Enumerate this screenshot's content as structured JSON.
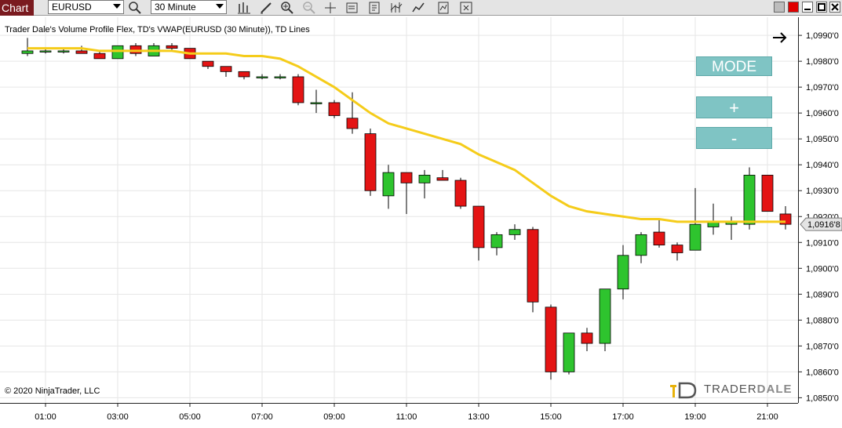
{
  "toolbar": {
    "tab_label": "Chart",
    "instrument": "EURUSD",
    "timeframe": "30 Minute",
    "icons": [
      "search-icon",
      "bar-type-icon",
      "draw-pencil-icon",
      "zoom-in-icon",
      "zoom-out-icon",
      "crosshair-icon",
      "data-box-icon",
      "properties-icon",
      "strategies-icon",
      "indicators-icon",
      "template-icon",
      "share-icon"
    ],
    "window_buttons": [
      "minimize",
      "restore",
      "maximize",
      "close"
    ]
  },
  "chart": {
    "indicator_label": "Trader Dale's Volume Profile Flex, TD's VWAP(EURUSD (30 Minute)), TD Lines",
    "copyright": "© 2020 NinjaTrader, LLC",
    "logo_text_1": "TRADER",
    "logo_text_2": "DALE",
    "mode_label": "MODE",
    "plus_label": "+",
    "minus_label": "-",
    "colors": {
      "up": "#2ec42e",
      "down": "#e41414",
      "vwap": "#f5cc1a",
      "grid": "#e6e6e6",
      "panel": "#7fc4c4"
    }
  },
  "chart_data": {
    "type": "candlestick",
    "title": "EURUSD (30 Minute)",
    "y_ticks": [
      "1,0990'0",
      "1,0980'0",
      "1,0970'0",
      "1,0960'0",
      "1,0950'0",
      "1,0940'0",
      "1,0930'0",
      "1,0920'0",
      "1,0910'0",
      "1,0900'0",
      "1,0890'0",
      "1,0880'0",
      "1,0870'0",
      "1,0860'0",
      "1,0850'0"
    ],
    "ylim": [
      1.0848,
      1.0997
    ],
    "x_ticks": [
      "01:00",
      "03:00",
      "05:00",
      "07:00",
      "09:00",
      "11:00",
      "13:00",
      "15:00",
      "17:00",
      "19:00",
      "21:00"
    ],
    "current_price_label": "1,0916'8",
    "candles": [
      {
        "o": 1.0983,
        "h": 1.0989,
        "l": 1.0982,
        "c": 1.0984
      },
      {
        "o": 1.0984,
        "h": 1.0985,
        "l": 1.0983,
        "c": 1.0984
      },
      {
        "o": 1.0984,
        "h": 1.0985,
        "l": 1.0983,
        "c": 1.0984
      },
      {
        "o": 1.0984,
        "h": 1.0986,
        "l": 1.0983,
        "c": 1.0983
      },
      {
        "o": 1.0983,
        "h": 1.0984,
        "l": 1.0981,
        "c": 1.0981
      },
      {
        "o": 1.0981,
        "h": 1.0986,
        "l": 1.0981,
        "c": 1.0986
      },
      {
        "o": 1.0986,
        "h": 1.0987,
        "l": 1.0982,
        "c": 1.0983
      },
      {
        "o": 1.0982,
        "h": 1.0987,
        "l": 1.0982,
        "c": 1.0986
      },
      {
        "o": 1.0986,
        "h": 1.0987,
        "l": 1.0984,
        "c": 1.0985
      },
      {
        "o": 1.0985,
        "h": 1.0985,
        "l": 1.0981,
        "c": 1.0981
      },
      {
        "o": 1.098,
        "h": 1.098,
        "l": 1.0977,
        "c": 1.0978
      },
      {
        "o": 1.0978,
        "h": 1.0978,
        "l": 1.0974,
        "c": 1.0976
      },
      {
        "o": 1.0976,
        "h": 1.0976,
        "l": 1.0973,
        "c": 1.0974
      },
      {
        "o": 1.0974,
        "h": 1.0975,
        "l": 1.0973,
        "c": 1.0974
      },
      {
        "o": 1.0974,
        "h": 1.0975,
        "l": 1.0973,
        "c": 1.0974
      },
      {
        "o": 1.0974,
        "h": 1.0975,
        "l": 1.0963,
        "c": 1.0964
      },
      {
        "o": 1.0964,
        "h": 1.0969,
        "l": 1.096,
        "c": 1.0964
      },
      {
        "o": 1.0964,
        "h": 1.0965,
        "l": 1.0958,
        "c": 1.0959
      },
      {
        "o": 1.0958,
        "h": 1.0968,
        "l": 1.0952,
        "c": 1.0954
      },
      {
        "o": 1.0952,
        "h": 1.0954,
        "l": 1.0928,
        "c": 1.093
      },
      {
        "o": 1.0928,
        "h": 1.094,
        "l": 1.0923,
        "c": 1.0937
      },
      {
        "o": 1.0937,
        "h": 1.0937,
        "l": 1.0921,
        "c": 1.0933
      },
      {
        "o": 1.0933,
        "h": 1.0938,
        "l": 1.0927,
        "c": 1.0936
      },
      {
        "o": 1.0935,
        "h": 1.0938,
        "l": 1.0934,
        "c": 1.0934
      },
      {
        "o": 1.0934,
        "h": 1.0935,
        "l": 1.0923,
        "c": 1.0924
      },
      {
        "o": 1.0924,
        "h": 1.0924,
        "l": 1.0903,
        "c": 1.0908
      },
      {
        "o": 1.0908,
        "h": 1.0914,
        "l": 1.0905,
        "c": 1.0913
      },
      {
        "o": 1.0913,
        "h": 1.0917,
        "l": 1.0911,
        "c": 1.0915
      },
      {
        "o": 1.0915,
        "h": 1.0916,
        "l": 1.0883,
        "c": 1.0887
      },
      {
        "o": 1.0885,
        "h": 1.0886,
        "l": 1.0857,
        "c": 1.086
      },
      {
        "o": 1.086,
        "h": 1.0875,
        "l": 1.0859,
        "c": 1.0875
      },
      {
        "o": 1.0875,
        "h": 1.0877,
        "l": 1.0868,
        "c": 1.0871
      },
      {
        "o": 1.0871,
        "h": 1.0892,
        "l": 1.0868,
        "c": 1.0892
      },
      {
        "o": 1.0892,
        "h": 1.0909,
        "l": 1.0888,
        "c": 1.0905
      },
      {
        "o": 1.0905,
        "h": 1.0914,
        "l": 1.0902,
        "c": 1.0913
      },
      {
        "o": 1.0914,
        "h": 1.0919,
        "l": 1.0908,
        "c": 1.0909
      },
      {
        "o": 1.0909,
        "h": 1.091,
        "l": 1.0903,
        "c": 1.0906
      },
      {
        "o": 1.0907,
        "h": 1.0931,
        "l": 1.0907,
        "c": 1.0917
      },
      {
        "o": 1.0916,
        "h": 1.0925,
        "l": 1.0913,
        "c": 1.0918
      },
      {
        "o": 1.0917,
        "h": 1.092,
        "l": 1.0911,
        "c": 1.0918
      },
      {
        "o": 1.0917,
        "h": 1.0939,
        "l": 1.0915,
        "c": 1.0936
      },
      {
        "o": 1.0936,
        "h": 1.0936,
        "l": 1.0922,
        "c": 1.0922
      },
      {
        "o": 1.0921,
        "h": 1.0924,
        "l": 1.0915,
        "c": 1.0917
      }
    ],
    "vwap": [
      1.0985,
      1.0985,
      1.0985,
      1.0985,
      1.0984,
      1.0984,
      1.0984,
      1.0984,
      1.0984,
      1.0983,
      1.0983,
      1.0983,
      1.0982,
      1.0982,
      1.0981,
      1.0978,
      1.0974,
      1.097,
      1.0965,
      1.096,
      1.0956,
      1.0954,
      1.0952,
      1.095,
      1.0948,
      1.0944,
      1.0941,
      1.0938,
      1.0933,
      1.0928,
      1.0924,
      1.0922,
      1.0921,
      1.092,
      1.0919,
      1.0919,
      1.0918,
      1.0918,
      1.0918,
      1.0918,
      1.0918,
      1.0918,
      1.0918
    ],
    "grid": true
  }
}
